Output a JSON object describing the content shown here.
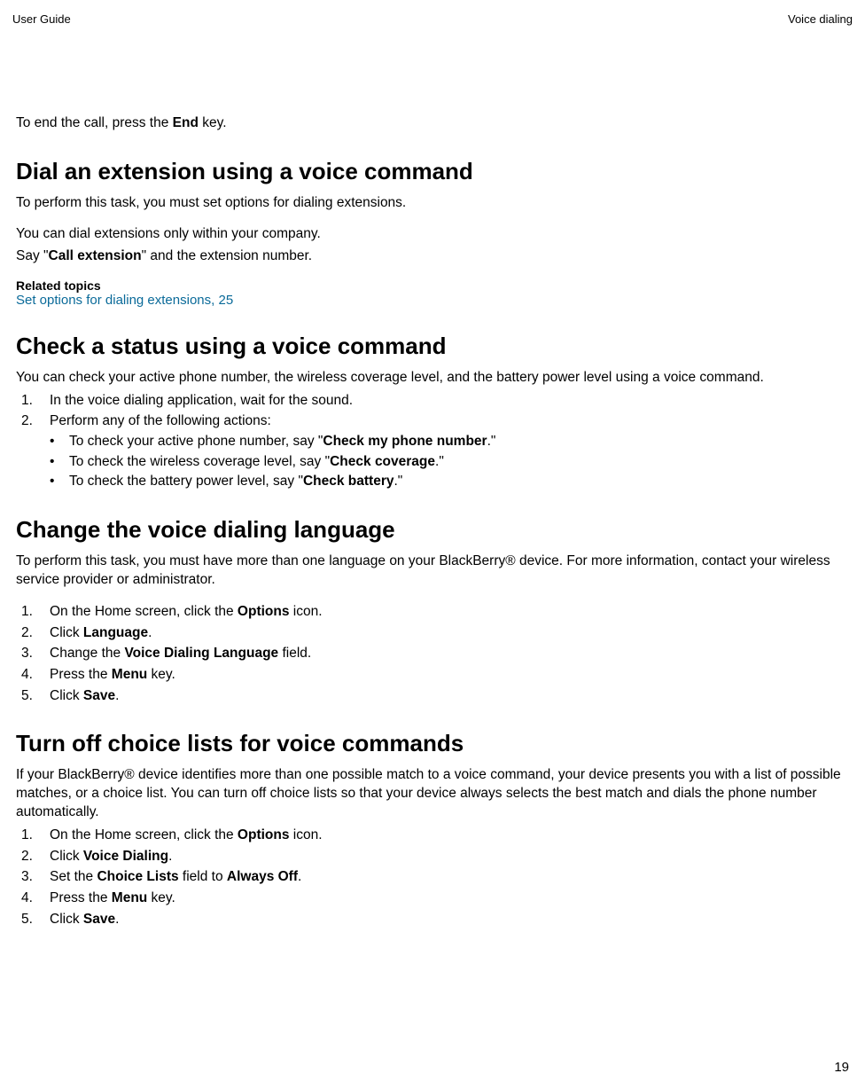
{
  "header": {
    "left": "User Guide",
    "right": "Voice dialing"
  },
  "intro_line": {
    "pre": "To end the call, press the ",
    "bold": "End",
    "post": " key."
  },
  "section_dial": {
    "heading": "Dial an extension using a voice command",
    "p1": "To perform this task, you must set options for dialing extensions.",
    "p2": "You can dial extensions only within your company.",
    "p3": {
      "pre": "Say \"",
      "bold": "Call extension",
      "post": "\" and the extension number."
    },
    "related_label": "Related topics",
    "related_link": "Set options for dialing extensions, 25"
  },
  "section_check": {
    "heading": "Check a status using a voice command",
    "p1": "You can check your active phone number, the wireless coverage level, and the battery power level using a voice command.",
    "steps": [
      {
        "num": "1.",
        "text": "In the voice dialing application, wait for the sound."
      },
      {
        "num": "2.",
        "text": "Perform any of the following actions:"
      }
    ],
    "bullets": [
      {
        "pre": "To check your active phone number, say \"",
        "bold": "Check my phone number",
        "post": ".\""
      },
      {
        "pre": "To check the wireless coverage level, say \"",
        "bold": "Check coverage",
        "post": ".\""
      },
      {
        "pre": "To check the battery power level, say \"",
        "bold": "Check battery",
        "post": ".\""
      }
    ]
  },
  "section_lang": {
    "heading": "Change the voice dialing language",
    "p1": "To perform this task, you must have more than one language on your BlackBerry® device. For more information, contact your wireless service provider or administrator.",
    "steps": [
      {
        "num": "1.",
        "pre": "On the Home screen, click the ",
        "bold": "Options",
        "post": " icon."
      },
      {
        "num": "2.",
        "pre": "Click ",
        "bold": "Language",
        "post": "."
      },
      {
        "num": "3.",
        "pre": "Change the ",
        "bold": "Voice Dialing Language",
        "post": " field."
      },
      {
        "num": "4.",
        "pre": "Press the ",
        "bold": "Menu",
        "post": " key."
      },
      {
        "num": "5.",
        "pre": "Click ",
        "bold": "Save",
        "post": "."
      }
    ]
  },
  "section_choice": {
    "heading": "Turn off choice lists for voice commands",
    "p1": "If your BlackBerry® device identifies more than one possible match to a voice command, your device presents you with a list of possible matches, or a choice list. You can turn off choice lists so that your device always selects the best match and dials the phone number automatically.",
    "steps": [
      {
        "num": "1.",
        "pre": "On the Home screen, click the ",
        "bold": "Options",
        "post": " icon."
      },
      {
        "num": "2.",
        "pre": "Click ",
        "bold": "Voice Dialing",
        "post": "."
      },
      {
        "num": "3.",
        "pre": "Set the ",
        "bold": "Choice Lists",
        "mid": " field to ",
        "bold2": "Always Off",
        "post": "."
      },
      {
        "num": "4.",
        "pre": "Press the ",
        "bold": "Menu",
        "post": " key."
      },
      {
        "num": "5.",
        "pre": "Click ",
        "bold": "Save",
        "post": "."
      }
    ]
  },
  "page_number": "19"
}
